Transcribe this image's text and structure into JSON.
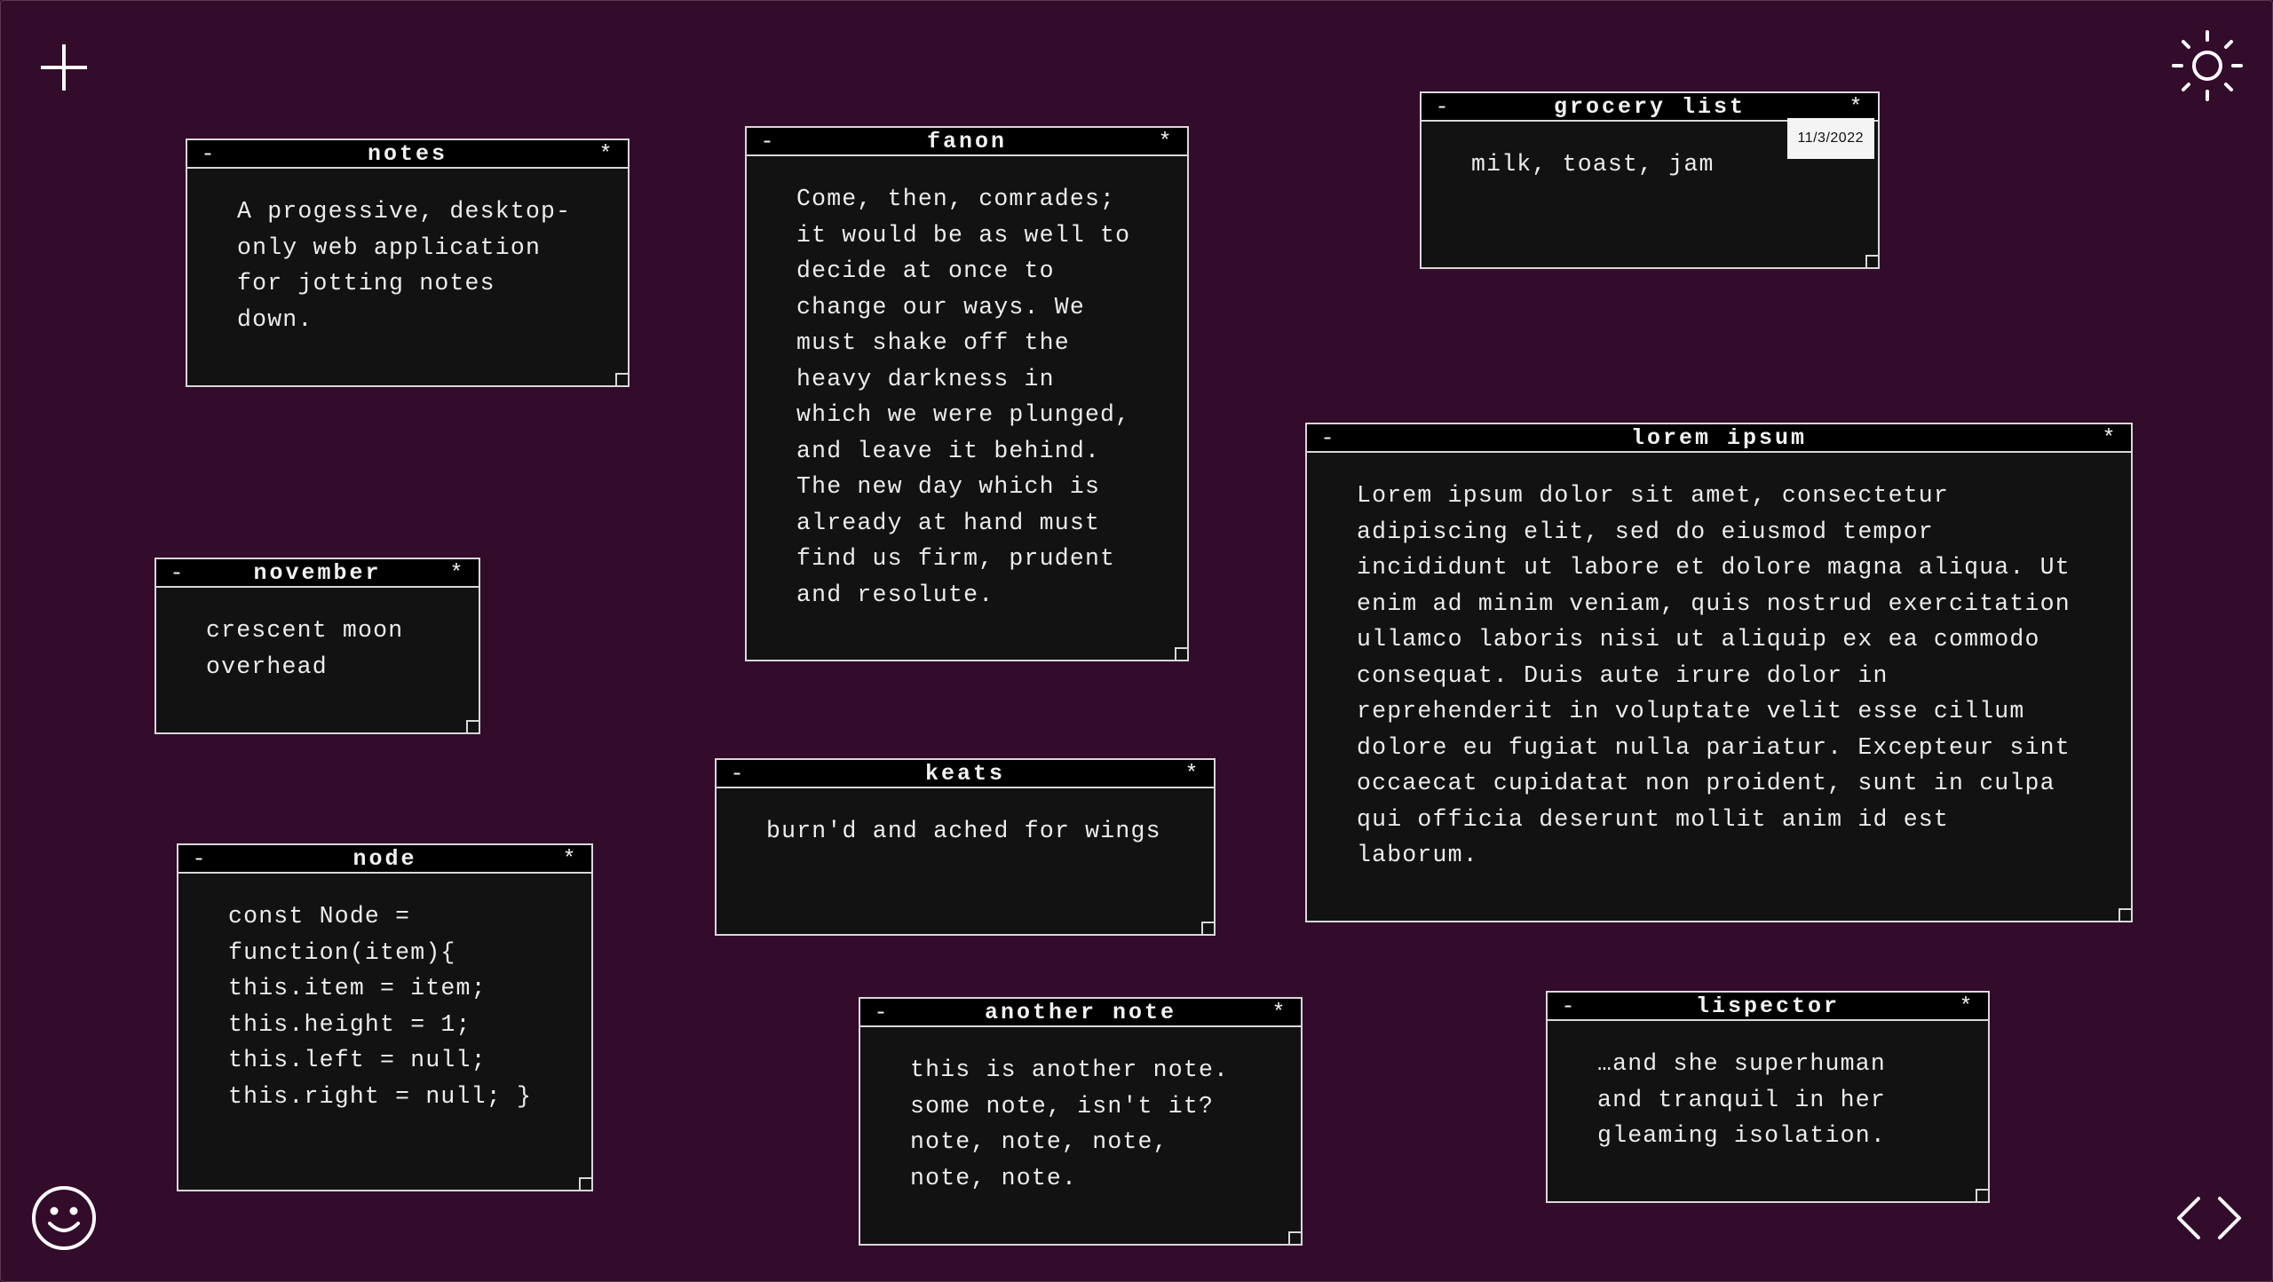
{
  "toolbar": {
    "add_icon": "plus-icon",
    "theme_icon": "sun-icon",
    "profile_icon": "smiley-icon",
    "code_icon": "code-brackets-icon"
  },
  "colors": {
    "background": "#330b2b",
    "note_background": "#121212",
    "title_bar": "#000000",
    "border": "#d8d8d8",
    "text": "#ececec"
  },
  "note_controls": {
    "minimize": "-",
    "menu": "*"
  },
  "notes": [
    {
      "title": "notes",
      "body": "A progessive, desktop-\nonly web application\nfor jotting notes\ndown."
    },
    {
      "title": "fanon",
      "body": "Come, then, comrades;\nit would be as well to\ndecide at once to\nchange our ways. We\nmust shake off the\nheavy darkness in\nwhich we were plunged,\nand leave it behind.\nThe new day which is\nalready at hand must\nfind us firm, prudent\nand resolute."
    },
    {
      "title": "grocery list",
      "body": "milk, toast, jam",
      "date": "11/3/2022"
    },
    {
      "title": "november",
      "body": "crescent moon\noverhead"
    },
    {
      "title": "lorem ipsum",
      "body": "Lorem ipsum dolor sit amet, consectetur\nadipiscing elit, sed do eiusmod tempor\nincididunt ut labore et dolore magna aliqua. Ut\nenim ad minim veniam, quis nostrud exercitation\nullamco laboris nisi ut aliquip ex ea commodo\nconsequat. Duis aute irure dolor in\nreprehenderit in voluptate velit esse cillum\ndolore eu fugiat nulla pariatur. Excepteur sint\noccaecat cupidatat non proident, sunt in culpa\nqui officia deserunt mollit anim id est\nlaborum."
    },
    {
      "title": "keats",
      "body": "burn'd and ached for wings"
    },
    {
      "title": "node",
      "body": "const Node =\nfunction(item){\nthis.item = item;\nthis.height = 1;\nthis.left = null;\nthis.right = null; }"
    },
    {
      "title": "another note",
      "body": "this is another note.\nsome note, isn't it?\nnote, note, note,\nnote, note."
    },
    {
      "title": "lispector",
      "body": "…and she superhuman\nand tranquil in her\ngleaming isolation."
    }
  ]
}
